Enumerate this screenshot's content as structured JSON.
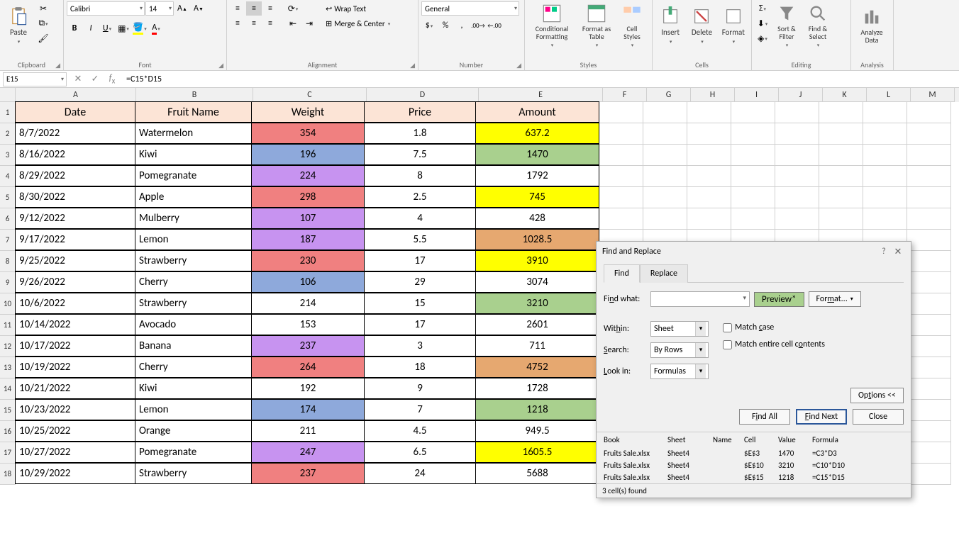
{
  "ribbon": {
    "clipboard": {
      "label": "Clipboard",
      "paste": "Paste"
    },
    "font": {
      "label": "Font",
      "name": "Calibri",
      "size": "14"
    },
    "alignment": {
      "label": "Alignment",
      "wrap": "Wrap Text",
      "merge": "Merge & Center"
    },
    "number": {
      "label": "Number",
      "format": "General"
    },
    "styles": {
      "label": "Styles",
      "conditional": "Conditional Formatting",
      "formatas": "Format as Table",
      "cell": "Cell Styles"
    },
    "cells": {
      "label": "Cells",
      "insert": "Insert",
      "delete": "Delete",
      "format": "Format"
    },
    "editing": {
      "label": "Editing",
      "sort": "Sort & Filter",
      "find": "Find & Select"
    },
    "analysis": {
      "label": "Analysis",
      "analyze": "Analyze Data"
    }
  },
  "formula_bar": {
    "name_box": "E15",
    "formula": "=C15*D15"
  },
  "columns": [
    "A",
    "B",
    "C",
    "D",
    "E",
    "F",
    "G",
    "H",
    "I",
    "J",
    "K",
    "L",
    "M"
  ],
  "col_widths_data": [
    170,
    165,
    160,
    158,
    175
  ],
  "empty_col_width": 62,
  "headers": [
    "Date",
    "Fruit Name",
    "Weight",
    "Price",
    "Amount"
  ],
  "rows": [
    {
      "r": 2,
      "date": "8/7/2022",
      "fruit": "Watermelon",
      "w": "354",
      "wc": "c-red",
      "p": "1.8",
      "a": "637.2",
      "ac": "c-yellow"
    },
    {
      "r": 3,
      "date": "8/16/2022",
      "fruit": "Kiwi",
      "w": "196",
      "wc": "c-blue",
      "p": "7.5",
      "a": "1470",
      "ac": "c-green"
    },
    {
      "r": 4,
      "date": "8/29/2022",
      "fruit": "Pomegranate",
      "w": "224",
      "wc": "c-purple",
      "p": "8",
      "a": "1792",
      "ac": ""
    },
    {
      "r": 5,
      "date": "8/30/2022",
      "fruit": "Apple",
      "w": "298",
      "wc": "c-red",
      "p": "2.5",
      "a": "745",
      "ac": "c-yellow"
    },
    {
      "r": 6,
      "date": "9/12/2022",
      "fruit": "Mulberry",
      "w": "107",
      "wc": "c-purple",
      "p": "4",
      "a": "428",
      "ac": ""
    },
    {
      "r": 7,
      "date": "9/17/2022",
      "fruit": "Lemon",
      "w": "187",
      "wc": "c-purple",
      "p": "5.5",
      "a": "1028.5",
      "ac": "c-orange"
    },
    {
      "r": 8,
      "date": "9/25/2022",
      "fruit": "Strawberry",
      "w": "230",
      "wc": "c-red",
      "p": "17",
      "a": "3910",
      "ac": "c-yellow"
    },
    {
      "r": 9,
      "date": "9/26/2022",
      "fruit": "Cherry",
      "w": "106",
      "wc": "c-blue",
      "p": "29",
      "a": "3074",
      "ac": ""
    },
    {
      "r": 10,
      "date": "10/6/2022",
      "fruit": "Strawberry",
      "w": "214",
      "wc": "",
      "p": "15",
      "a": "3210",
      "ac": "c-green"
    },
    {
      "r": 11,
      "date": "10/14/2022",
      "fruit": "Avocado",
      "w": "153",
      "wc": "",
      "p": "17",
      "a": "2601",
      "ac": ""
    },
    {
      "r": 12,
      "date": "10/17/2022",
      "fruit": "Banana",
      "w": "237",
      "wc": "c-purple",
      "p": "3",
      "a": "711",
      "ac": ""
    },
    {
      "r": 13,
      "date": "10/19/2022",
      "fruit": "Cherry",
      "w": "264",
      "wc": "c-red",
      "p": "18",
      "a": "4752",
      "ac": "c-orange"
    },
    {
      "r": 14,
      "date": "10/21/2022",
      "fruit": "Kiwi",
      "w": "192",
      "wc": "",
      "p": "9",
      "a": "1728",
      "ac": ""
    },
    {
      "r": 15,
      "date": "10/23/2022",
      "fruit": "Lemon",
      "w": "174",
      "wc": "c-blue",
      "p": "7",
      "a": "1218",
      "ac": "c-green"
    },
    {
      "r": 16,
      "date": "10/25/2022",
      "fruit": "Orange",
      "w": "211",
      "wc": "",
      "p": "4.5",
      "a": "949.5",
      "ac": ""
    },
    {
      "r": 17,
      "date": "10/27/2022",
      "fruit": "Pomegranate",
      "w": "247",
      "wc": "c-purple",
      "p": "6.5",
      "a": "1605.5",
      "ac": "c-yellow"
    },
    {
      "r": 18,
      "date": "10/29/2022",
      "fruit": "Strawberry",
      "w": "237",
      "wc": "c-red",
      "p": "24",
      "a": "5688",
      "ac": ""
    }
  ],
  "row_height_header": 30,
  "row_height_data": 30,
  "dialog": {
    "title": "Find and Replace",
    "tabs": {
      "find": "Find",
      "replace": "Replace"
    },
    "find_what": "Find what:",
    "preview": "Preview*",
    "format_btn": "Format...",
    "within": {
      "label": "Within:",
      "value": "Sheet"
    },
    "search": {
      "label": "Search:",
      "value": "By Rows"
    },
    "lookin": {
      "label": "Look in:",
      "value": "Formulas"
    },
    "match_case": "Match case",
    "match_contents": "Match entire cell contents",
    "options": "Options <<",
    "find_all": "Find All",
    "find_next": "Find Next",
    "close": "Close",
    "cols": {
      "book": "Book",
      "sheet": "Sheet",
      "name": "Name",
      "cell": "Cell",
      "value": "Value",
      "formula": "Formula"
    },
    "results": [
      {
        "book": "Fruits Sale.xlsx",
        "sheet": "Sheet4",
        "name": "",
        "cell": "$E$3",
        "value": "1470",
        "formula": "=C3*D3"
      },
      {
        "book": "Fruits Sale.xlsx",
        "sheet": "Sheet4",
        "name": "",
        "cell": "$E$10",
        "value": "3210",
        "formula": "=C10*D10"
      },
      {
        "book": "Fruits Sale.xlsx",
        "sheet": "Sheet4",
        "name": "",
        "cell": "$E$15",
        "value": "1218",
        "formula": "=C15*D15"
      }
    ],
    "status": "3 cell(s) found"
  }
}
